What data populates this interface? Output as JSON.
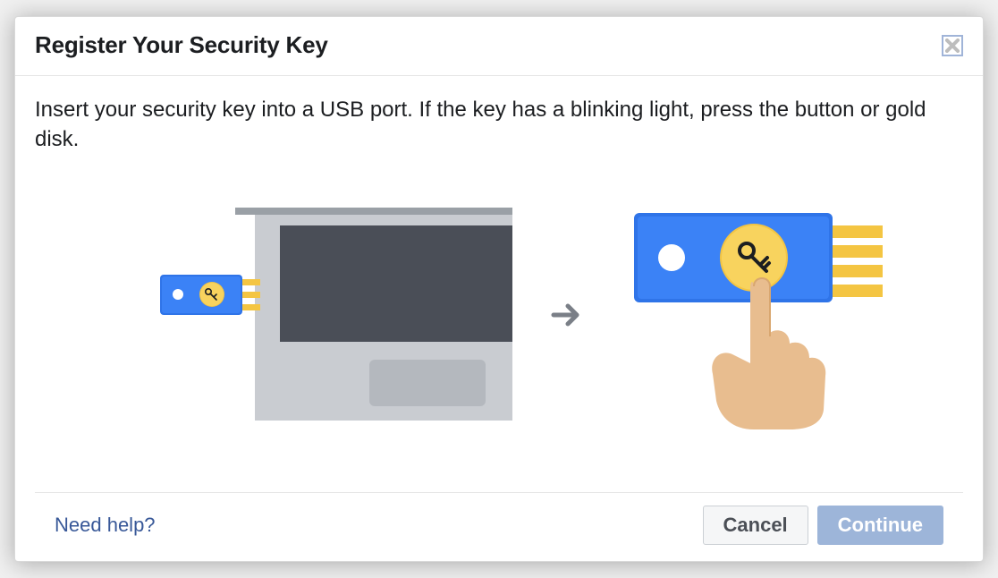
{
  "dialog": {
    "title": "Register Your Security Key",
    "instruction": "Insert your security key into a USB port. If the key has a blinking light, press the button or gold disk.",
    "help_link": "Need help?",
    "cancel_label": "Cancel",
    "continue_label": "Continue"
  }
}
